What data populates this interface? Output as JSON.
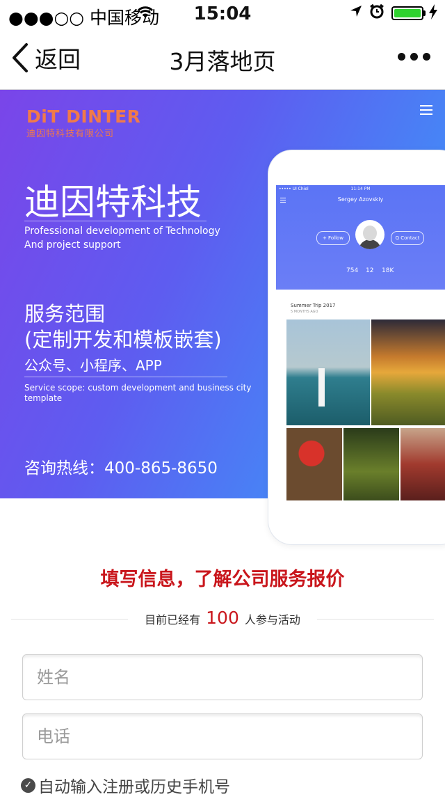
{
  "status_bar": {
    "carrier": "●●●○○ 中国移动",
    "time": "15:04",
    "battery_level": 1.0
  },
  "nav": {
    "back_label": "返回",
    "title": "3月落地页"
  },
  "banner": {
    "logo_en": "DiT DINTER",
    "logo_cn": "迪因特科技有限公司",
    "title": "迪因特科技",
    "subtitle_1": "Professional development of Technology",
    "subtitle_2": "And project support",
    "service_1": "服务范围",
    "service_2": "(定制开发和模板嵌套)",
    "service_3": "公众号、小程序、APP",
    "service_en_1": "Service scope: custom development and business city",
    "service_en_2": "template",
    "hotline": "咨询热线：400-865-8650"
  },
  "mockup": {
    "status": "••••• UI Chiel",
    "time": "11:14 PM",
    "profile_name": "Sergey Azovskiy",
    "follow_label": "+ Follow",
    "contact_label": "Q Contact",
    "stat_1": "754",
    "stat_2": "12",
    "stat_3": "18K",
    "card_title": "Summer Trip 2017",
    "card_sub": "5 MONTHS AGO"
  },
  "form": {
    "heading": "填写信息，了解公司服务报价",
    "count_prefix": "目前已经有",
    "count": "100",
    "count_suffix": "人参与活动",
    "name_placeholder": "姓名",
    "phone_placeholder": "电话",
    "auto_fill_label": "自动输入注册或历史手机号"
  },
  "colors": {
    "accent_red": "#c9161c",
    "banner_start": "#7a45e9",
    "banner_end": "#3e96f8",
    "logo_orange": "#f07a4a"
  }
}
